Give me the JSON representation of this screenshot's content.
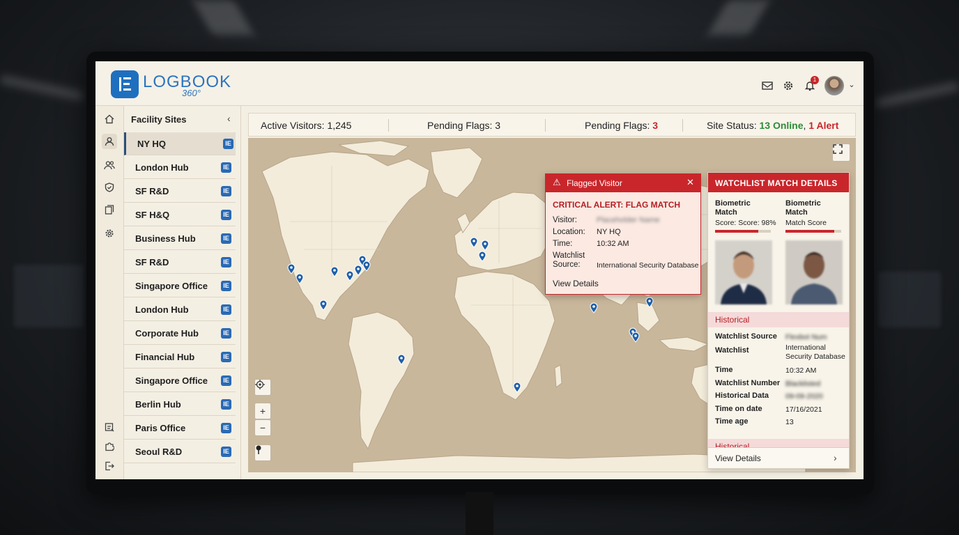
{
  "app": {
    "logo_text": "LOGBOOK",
    "logo_sub": "360°"
  },
  "header_icons": [
    "mail-icon",
    "gear-icon",
    "bell-icon",
    "avatar",
    "chevron-down-icon"
  ],
  "notifications": {
    "count": "1"
  },
  "rail": [
    "home-icon",
    "user-icon",
    "users-icon",
    "shield-icon",
    "documents-icon",
    "settings-icon",
    "report-icon",
    "puzzle-icon",
    "logout-icon"
  ],
  "sites": {
    "title": "Facility Sites",
    "collapse": "‹",
    "items": [
      "NY HQ",
      "London Hub",
      "SF R&D",
      "SF H&Q",
      "Business Hub",
      "SF R&D",
      "Singapore Office",
      "London Hub",
      "Corporate Hub",
      "Financial Hub",
      "Singapore Office",
      "Berlin Hub",
      "Paris Office",
      "Seoul R&D"
    ],
    "item_icon": "IE"
  },
  "stats": {
    "active_label": "Active Visitors: ",
    "active_value": "1,245",
    "pending1_label": "Pending Flags: ",
    "pending1_value": "3",
    "pending2_label": "Pending Flags: ",
    "pending2_value": "3",
    "status_label": "Site Status: ",
    "status_online": "13 Online",
    "status_sep": ", ",
    "status_alert": "1 Alert"
  },
  "colors": {
    "accent": "#c9262b",
    "brand": "#1f6fbf",
    "online": "#2e8b3a",
    "map": "#c9b79c",
    "land": "#f3ecdb"
  },
  "flag_popup": {
    "title": "Flagged Visitor",
    "critical": "CRITICAL ALERT: FLAG MATCH",
    "visitor_label": "Visitor:",
    "visitor_value": "Placeholder Name",
    "location_label": "Location:",
    "location_value": "NY HQ",
    "time_label": "Time:",
    "time_value": "10:32 AM",
    "source_label_1": "Watchlist",
    "source_label_2": "Source:",
    "source_value": "International Security Database",
    "link": "View Details"
  },
  "watchlist": {
    "title": "WATCHLIST MATCH DETAILS",
    "bm1_l1": "Biometric",
    "bm1_l2": "Match",
    "bm1_score": "Score: Score: 98%",
    "bm1_level": 0.77,
    "bm2_l1": "Biometric",
    "bm2_l2": "Match",
    "bm2_score": "Match Score",
    "bm2_level": 0.88,
    "historical": "Historical",
    "rows": [
      {
        "label": "Watchlist Source",
        "value": "Flexbot Num",
        "blur": true
      },
      {
        "label": "Watchlist",
        "value": "International Security Database",
        "blur": false
      },
      {
        "label": "Time",
        "value": "10:32 AM",
        "blur": false
      },
      {
        "label": "Watchlist Number",
        "value": "Blacklisted",
        "blur": true
      },
      {
        "label": "Historical Data",
        "value": "09-09-2020",
        "blur": true
      },
      {
        "label": "Time on date",
        "value": "17/16/2021",
        "blur": false
      },
      {
        "label": "Time age",
        "value": "13",
        "blur": false
      }
    ],
    "historical2": "Historical",
    "footer_link": "View Details"
  }
}
